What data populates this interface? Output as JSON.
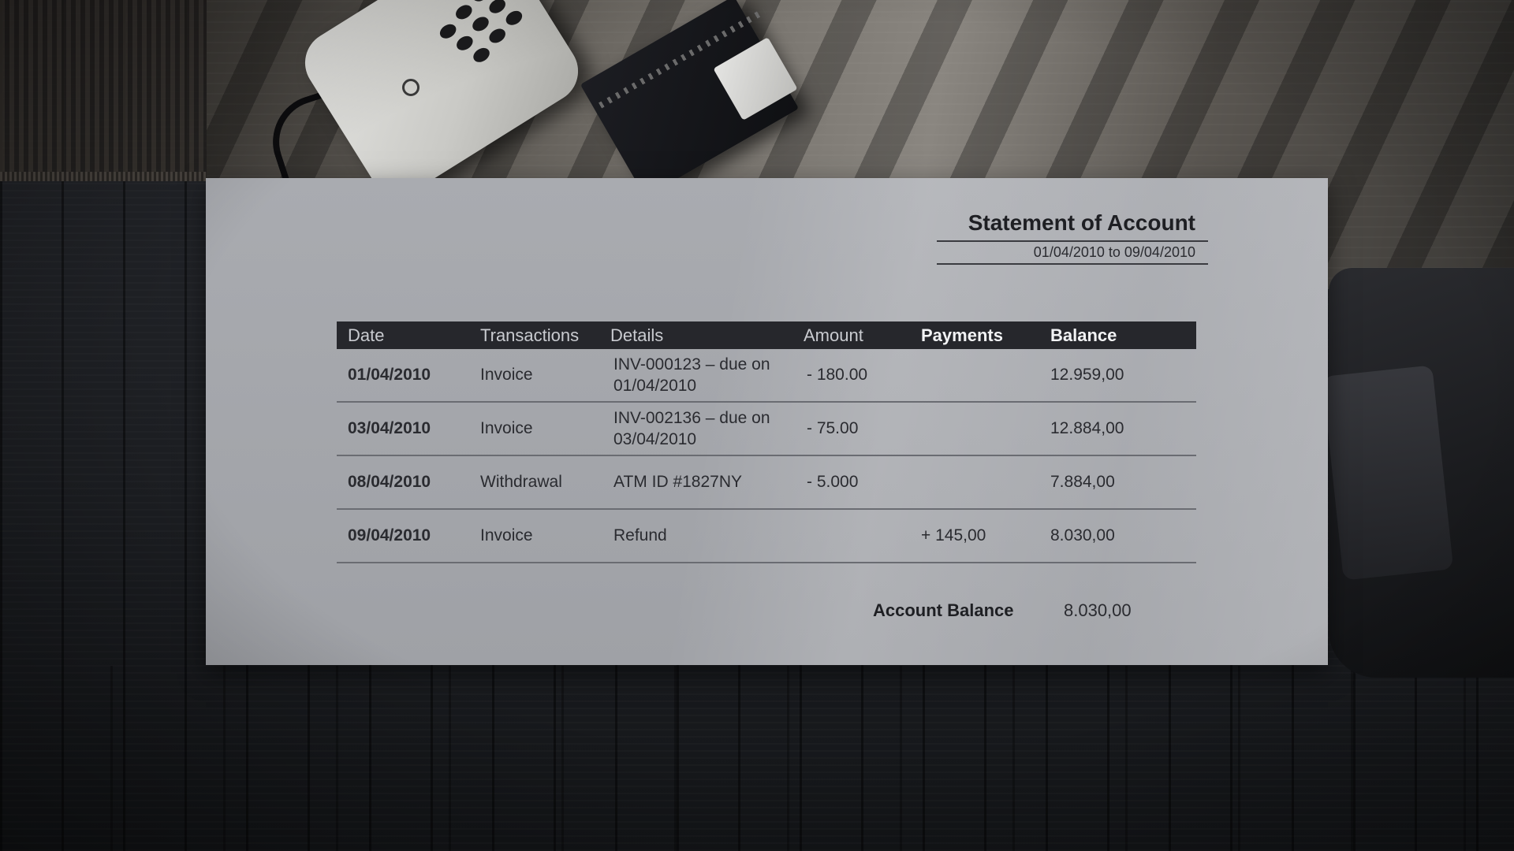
{
  "statement": {
    "title": "Statement of Account",
    "date_range": "01/04/2010 to 09/04/2010",
    "columns": [
      "Date",
      "Transactions",
      "Details",
      "Amount",
      "Payments",
      "Balance"
    ],
    "rows": [
      {
        "date": "01/04/2010",
        "transaction": "Invoice",
        "details": "INV-000123 – due on 01/04/2010",
        "amount": "- 180.00",
        "payment": "",
        "balance": "12.959,00"
      },
      {
        "date": "03/04/2010",
        "transaction": "Invoice",
        "details": "INV-002136 – due on 03/04/2010",
        "amount": "- 75.00",
        "payment": "",
        "balance": "12.884,00"
      },
      {
        "date": "08/04/2010",
        "transaction": "Withdrawal",
        "details": "ATM ID #1827NY",
        "amount": "- 5.000",
        "payment": "",
        "balance": "7.884,00"
      },
      {
        "date": "09/04/2010",
        "transaction": "Invoice",
        "details": "Refund",
        "amount": "",
        "payment": "+ 145,00",
        "balance": "8.030,00"
      }
    ],
    "account_balance_label": "Account Balance",
    "account_balance_value": "8.030,00"
  },
  "colors": {
    "paper": "#a3a5aa",
    "header_bar": "#26272c",
    "header_text": "#c9cbd0",
    "body_text": "#2a2b30"
  },
  "scene_objects": [
    "telephone",
    "notebook",
    "desk",
    "rug",
    "chair",
    "wooden-floor"
  ]
}
